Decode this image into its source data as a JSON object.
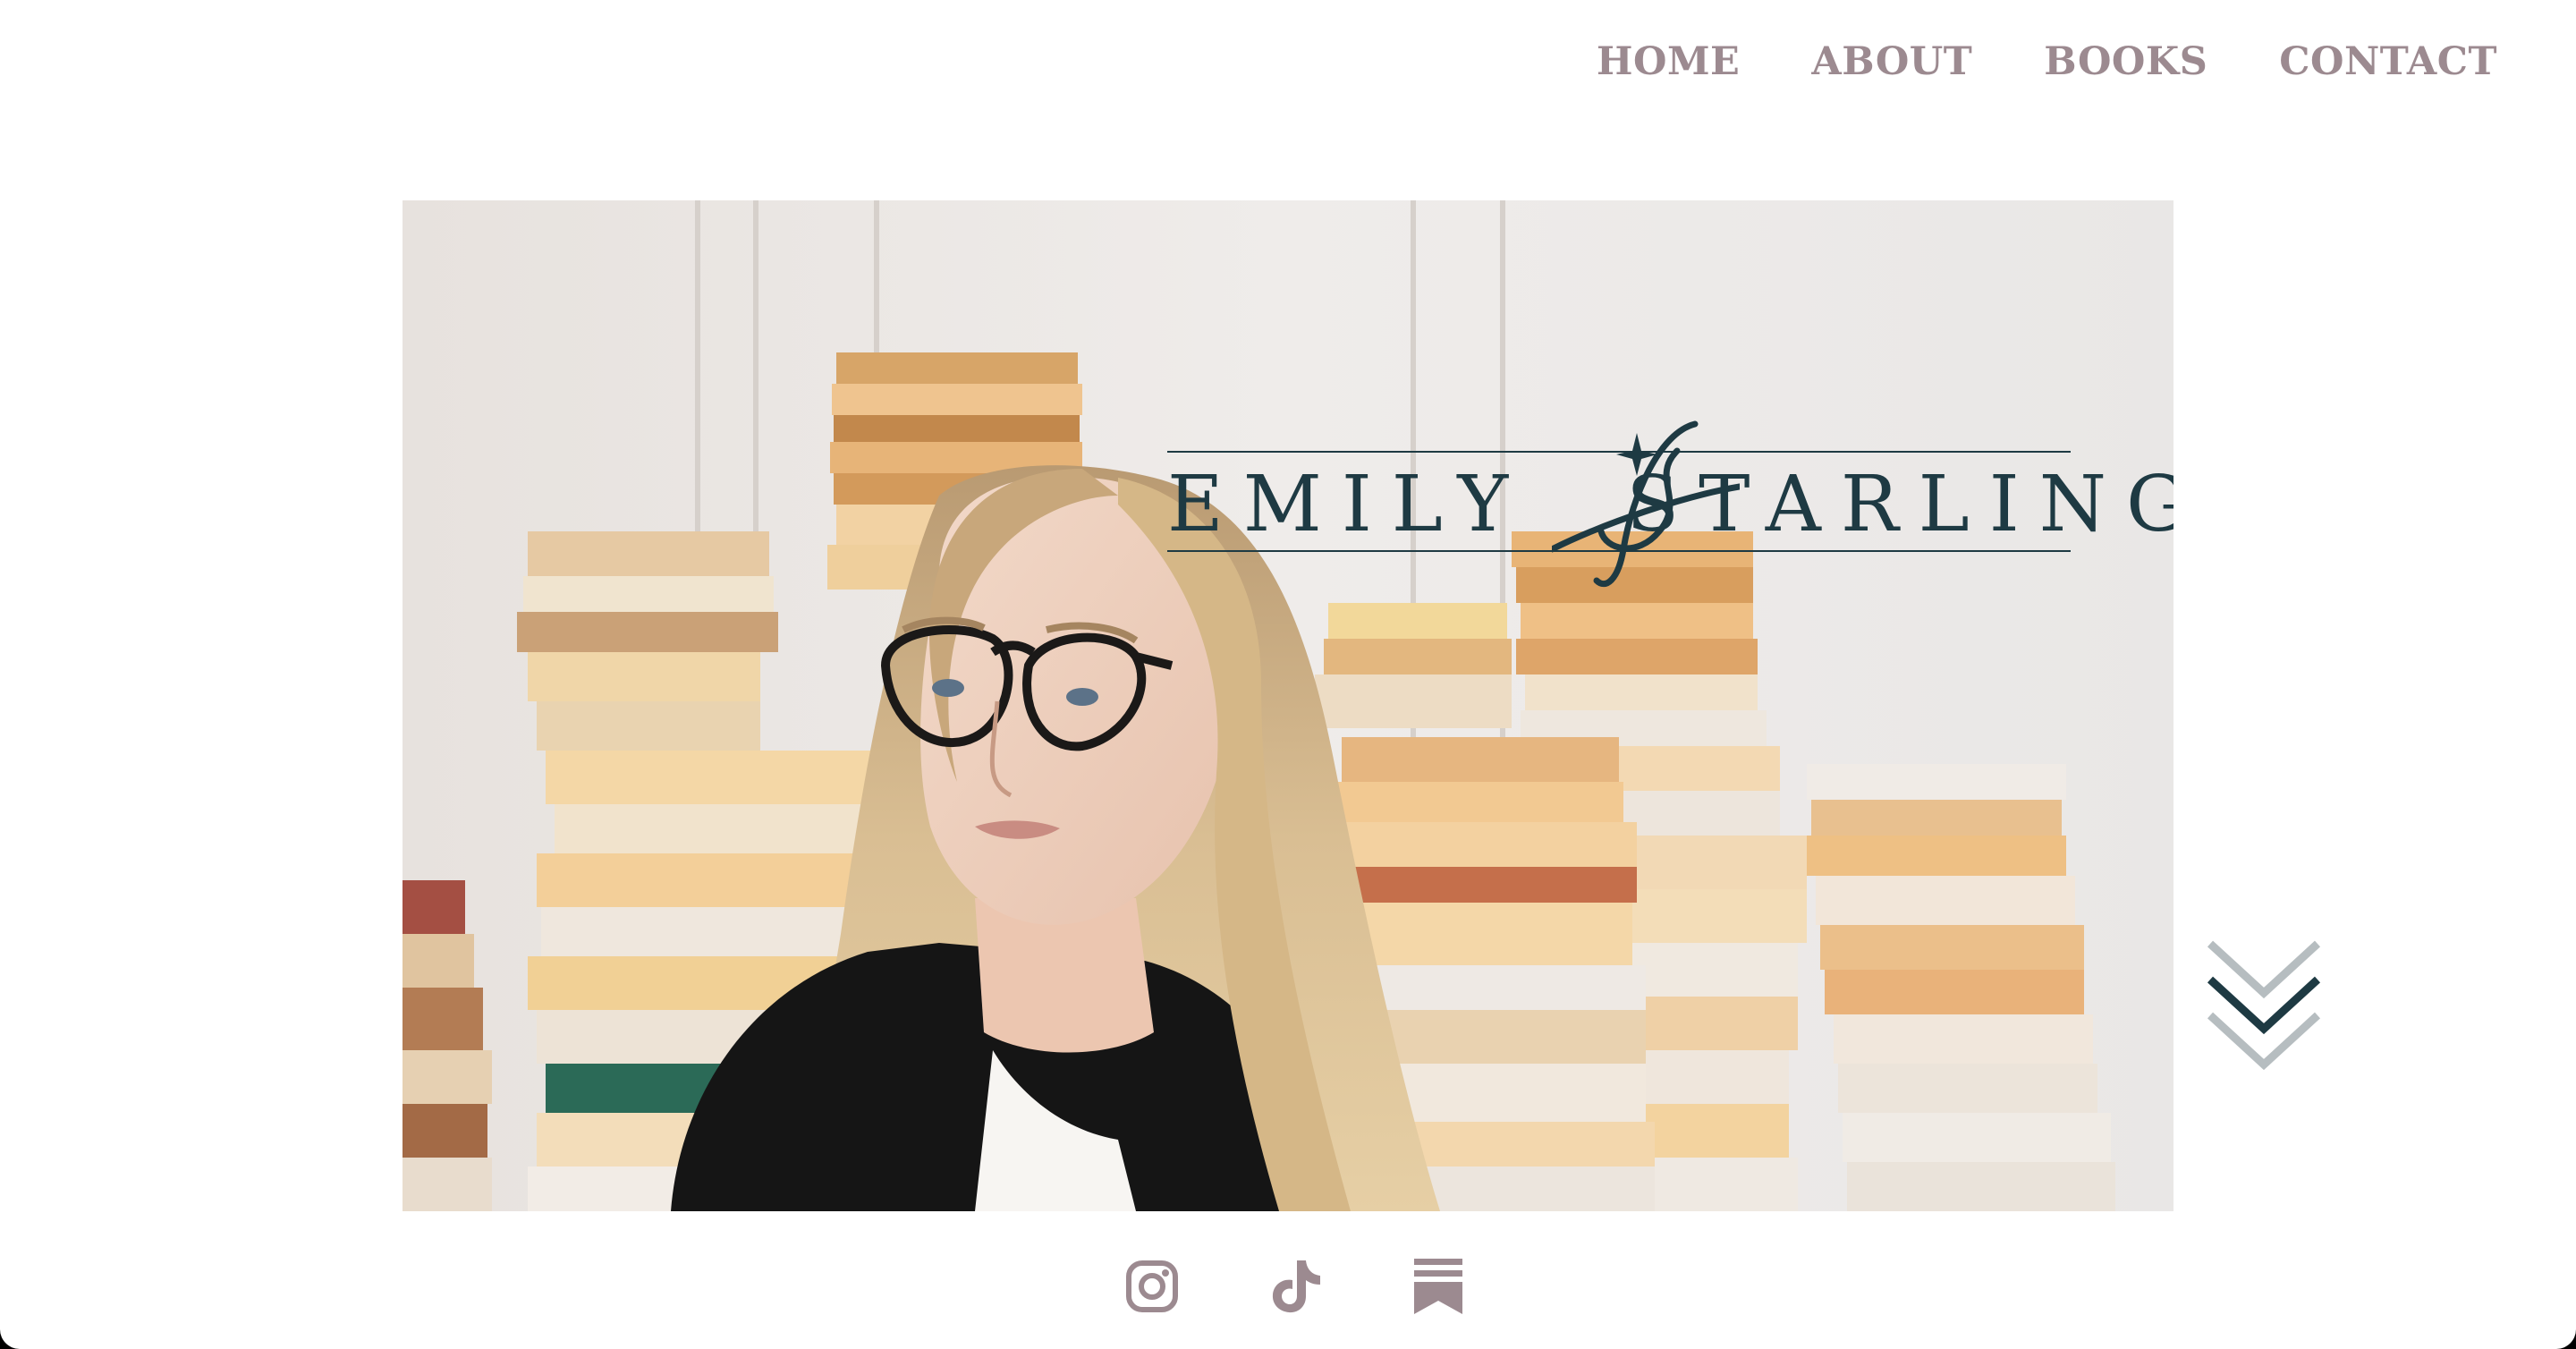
{
  "nav": {
    "items": [
      {
        "label": "HOME"
      },
      {
        "label": "ABOUT"
      },
      {
        "label": "BOOKS"
      },
      {
        "label": "CONTACT"
      }
    ]
  },
  "hero": {
    "logo_left": "EMILY",
    "logo_right": "STARLING",
    "logo_monogram": "ES",
    "scroll_icon": "chevron-down-double-icon"
  },
  "social": {
    "icons": [
      "instagram-icon",
      "tiktok-icon",
      "substack-icon"
    ]
  },
  "colors": {
    "nav_text": "#9c8a90",
    "logo": "#1e3a43",
    "social_icon": "#9c8a90",
    "chevron_dark": "#1e3a43",
    "chevron_light": "#b6bdc0"
  }
}
